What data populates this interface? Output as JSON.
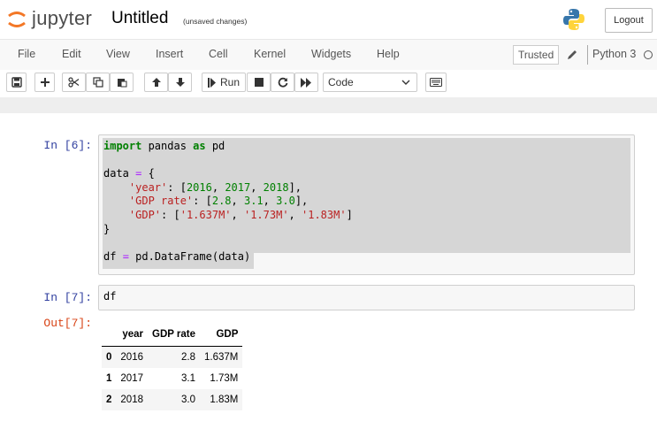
{
  "header": {
    "logo_text": "jupyter",
    "title": "Untitled",
    "status": "(unsaved changes)",
    "logout_label": "Logout"
  },
  "menubar": {
    "items": [
      "File",
      "Edit",
      "View",
      "Insert",
      "Cell",
      "Kernel",
      "Widgets",
      "Help"
    ],
    "trusted_label": "Trusted",
    "kernel_name": "Python 3"
  },
  "toolbar": {
    "run_label": "Run",
    "cell_type": "Code",
    "buttons": [
      "save-icon",
      "plus-icon",
      "scissors-icon",
      "copy-icon",
      "paste-icon",
      "arrow-up-icon",
      "arrow-down-icon",
      "run",
      "stop-icon",
      "restart-icon",
      "fast-forward-icon",
      "cell-type-select",
      "keyboard-icon"
    ]
  },
  "cells": [
    {
      "prompt": "In [6]:",
      "lines": [
        "import pandas as pd",
        "",
        "data = {",
        "    'year': [2016, 2017, 2018],",
        "    'GDP rate': [2.8, 3.1, 3.0],",
        "    'GDP': ['1.637M', '1.73M', '1.83M']",
        "}",
        "",
        "df = pd.DataFrame(data)"
      ]
    },
    {
      "prompt": "In [7]:",
      "lines": [
        "df"
      ],
      "out_prompt": "Out[7]:",
      "output_table": {
        "columns": [
          "",
          "year",
          "GDP rate",
          "GDP"
        ],
        "rows": [
          [
            "0",
            "2016",
            "2.8",
            "1.637M"
          ],
          [
            "1",
            "2017",
            "3.1",
            "1.73M"
          ],
          [
            "2",
            "2018",
            "3.0",
            "1.83M"
          ]
        ]
      }
    }
  ],
  "colors": {
    "keyword": "#008000",
    "string": "#ba2121",
    "number": "#008000",
    "operator": "#aa22ff",
    "in_prompt": "#303f9f",
    "out_prompt": "#d84315"
  }
}
